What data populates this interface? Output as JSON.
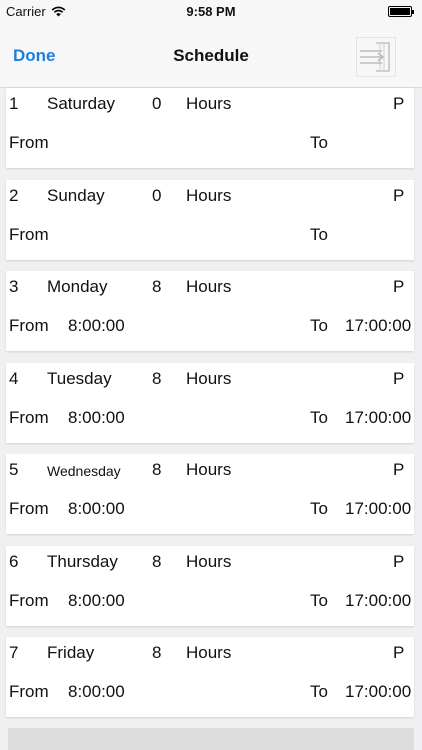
{
  "status_bar": {
    "carrier": "Carrier",
    "time": "9:58 PM"
  },
  "nav": {
    "done_label": "Done",
    "title": "Schedule",
    "right_icon": "import-icon",
    "accent_color": "#1f7fd8"
  },
  "days": [
    {
      "num": "1",
      "name": "Saturday",
      "hours": "0",
      "hours_label": "Hours",
      "flag": "P",
      "from_label": "From",
      "from": "",
      "to_label": "To",
      "to": ""
    },
    {
      "num": "2",
      "name": "Sunday",
      "hours": "0",
      "hours_label": "Hours",
      "flag": "P",
      "from_label": "From",
      "from": "",
      "to_label": "To",
      "to": ""
    },
    {
      "num": "3",
      "name": "Monday",
      "hours": "8",
      "hours_label": "Hours",
      "flag": "P",
      "from_label": "From",
      "from": "8:00:00",
      "to_label": "To",
      "to": "17:00:00"
    },
    {
      "num": "4",
      "name": "Tuesday",
      "hours": "8",
      "hours_label": "Hours",
      "flag": "P",
      "from_label": "From",
      "from": "8:00:00",
      "to_label": "To",
      "to": "17:00:00"
    },
    {
      "num": "5",
      "name": "Wednesday",
      "hours": "8",
      "hours_label": "Hours",
      "flag": "P",
      "from_label": "From",
      "from": "8:00:00",
      "to_label": "To",
      "to": "17:00:00"
    },
    {
      "num": "6",
      "name": "Thursday",
      "hours": "8",
      "hours_label": "Hours",
      "flag": "P",
      "from_label": "From",
      "from": "8:00:00",
      "to_label": "To",
      "to": "17:00:00"
    },
    {
      "num": "7",
      "name": "Friday",
      "hours": "8",
      "hours_label": "Hours",
      "flag": "P",
      "from_label": "From",
      "from": "8:00:00",
      "to_label": "To",
      "to": "17:00:00"
    }
  ]
}
